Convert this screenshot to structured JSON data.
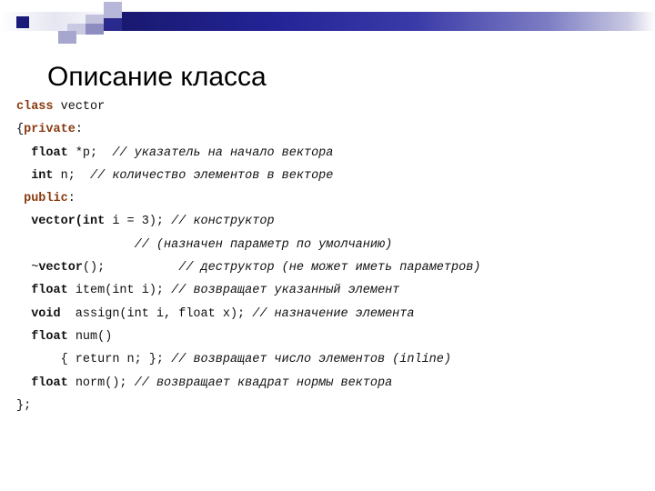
{
  "slide": {
    "title": "Описание класса",
    "accent_color": "#191970",
    "access_keyword_color": "#8a3b10",
    "text_color": "#111111"
  },
  "header_decoration": {
    "name": "powerpoint-band-decoration",
    "squares": [
      "dark-square",
      "light-square-1",
      "light-square-2",
      "light-square-3",
      "light-square-4",
      "light-square-5",
      "light-square-6"
    ]
  },
  "code": {
    "lines": [
      {
        "id": "line-class-vector",
        "parts": [
          {
            "t": "class",
            "s": "kw-access"
          },
          {
            "t": " vector",
            "s": "plain"
          }
        ]
      },
      {
        "id": "line-open-brace-private",
        "parts": [
          {
            "t": "{",
            "s": "plain"
          },
          {
            "t": "private",
            "s": "kw-access"
          },
          {
            "t": ":",
            "s": "plain"
          }
        ]
      },
      {
        "id": "line-float-p",
        "parts": [
          {
            "t": "  ",
            "s": "plain"
          },
          {
            "t": "float",
            "s": "kw"
          },
          {
            "t": " *p;  ",
            "s": "plain"
          },
          {
            "t": "// указатель на начало вектора",
            "s": "cmt"
          }
        ]
      },
      {
        "id": "line-int-n",
        "parts": [
          {
            "t": "  ",
            "s": "plain"
          },
          {
            "t": "int",
            "s": "kw"
          },
          {
            "t": " n;  ",
            "s": "plain"
          },
          {
            "t": "// количество элементов в векторе",
            "s": "cmt"
          }
        ]
      },
      {
        "id": "line-public",
        "parts": [
          {
            "t": " ",
            "s": "plain"
          },
          {
            "t": "public",
            "s": "kw-access"
          },
          {
            "t": ":",
            "s": "plain"
          }
        ]
      },
      {
        "id": "line-constructor",
        "parts": [
          {
            "t": "  ",
            "s": "plain"
          },
          {
            "t": "vector(int",
            "s": "kw"
          },
          {
            "t": " i = 3); ",
            "s": "plain"
          },
          {
            "t": "// конструктор",
            "s": "cmt"
          }
        ]
      },
      {
        "id": "line-constructor-comment-2",
        "parts": [
          {
            "t": "                ",
            "s": "plain"
          },
          {
            "t": "// (назначен параметр по умолчанию)",
            "s": "cmt"
          }
        ]
      },
      {
        "id": "line-destructor",
        "parts": [
          {
            "t": "  ~",
            "s": "plain"
          },
          {
            "t": "vector",
            "s": "kw"
          },
          {
            "t": "();          ",
            "s": "plain"
          },
          {
            "t": "// деструктор (не может иметь параметров)",
            "s": "cmt"
          }
        ]
      },
      {
        "id": "line-item",
        "parts": [
          {
            "t": "  ",
            "s": "plain"
          },
          {
            "t": "float",
            "s": "kw"
          },
          {
            "t": " item(int i); ",
            "s": "plain"
          },
          {
            "t": "// возвращает указанный элемент",
            "s": "cmt"
          }
        ]
      },
      {
        "id": "line-assign",
        "parts": [
          {
            "t": "  ",
            "s": "plain"
          },
          {
            "t": "void",
            "s": "kw"
          },
          {
            "t": "  assign(int i, float x); ",
            "s": "plain"
          },
          {
            "t": "// назначение элемента",
            "s": "cmt"
          }
        ]
      },
      {
        "id": "line-num",
        "parts": [
          {
            "t": "  ",
            "s": "plain"
          },
          {
            "t": "float",
            "s": "kw"
          },
          {
            "t": " num()",
            "s": "plain"
          }
        ]
      },
      {
        "id": "line-num-body",
        "parts": [
          {
            "t": "      { return n; }; ",
            "s": "plain"
          },
          {
            "t": "// возвращает число элементов (inline)",
            "s": "cmt"
          }
        ]
      },
      {
        "id": "line-norm",
        "parts": [
          {
            "t": "  ",
            "s": "plain"
          },
          {
            "t": "float",
            "s": "kw"
          },
          {
            "t": " norm(); ",
            "s": "plain"
          },
          {
            "t": "// возвращает квадрат нормы вектора",
            "s": "cmt"
          }
        ]
      },
      {
        "id": "line-close",
        "parts": [
          {
            "t": "};",
            "s": "plain"
          }
        ]
      }
    ]
  }
}
